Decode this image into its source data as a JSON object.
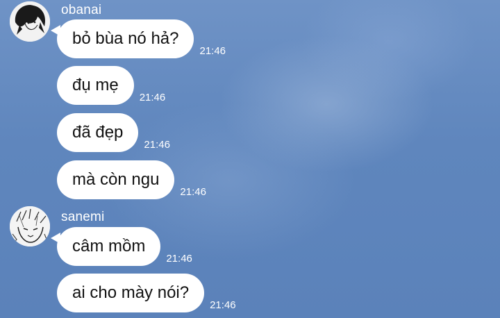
{
  "groups": [
    {
      "sender": "obanai",
      "avatar_icon": "dark-hair-character-avatar-icon",
      "messages": [
        {
          "text": "bỏ bùa nó hả?",
          "time": "21:46"
        },
        {
          "text": "đụ mẹ",
          "time": "21:46"
        },
        {
          "text": "đã đẹp",
          "time": "21:46"
        },
        {
          "text": "mà còn ngu",
          "time": "21:46"
        }
      ]
    },
    {
      "sender": "sanemi",
      "avatar_icon": "sketch-character-avatar-icon",
      "messages": [
        {
          "text": "câm mồm",
          "time": "21:46"
        },
        {
          "text": "ai cho mày nói?",
          "time": "21:46"
        }
      ]
    }
  ]
}
